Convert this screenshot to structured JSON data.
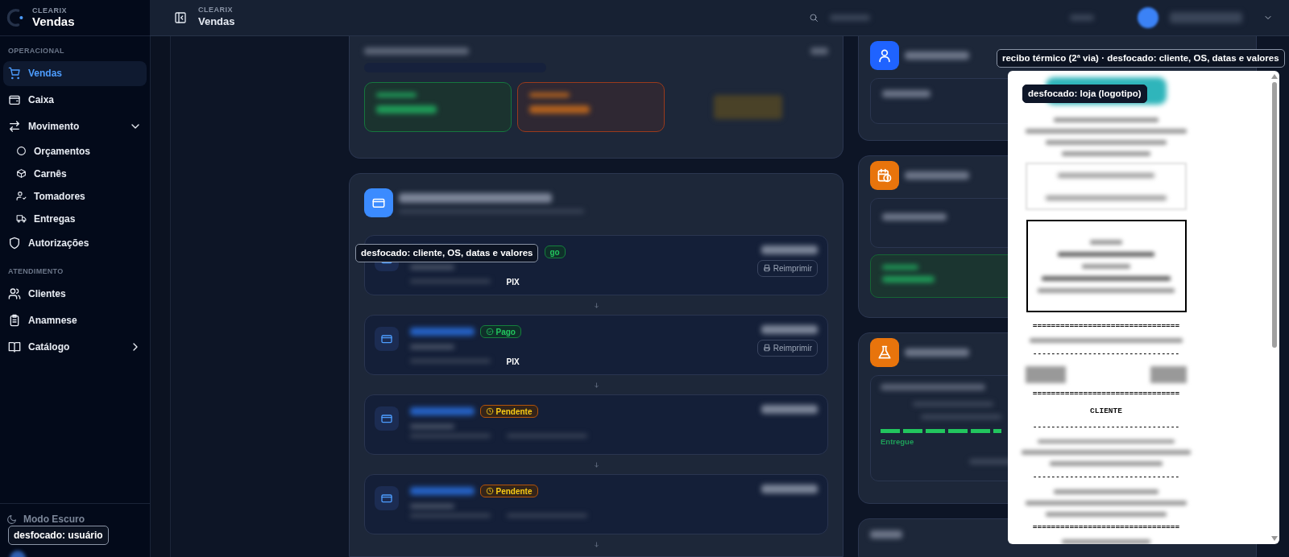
{
  "sidebar": {
    "brand": "CLEARIX",
    "title": "Vendas",
    "sections": [
      {
        "heading": "OPERACIONAL",
        "items": [
          {
            "label": "Vendas",
            "selected": true
          },
          {
            "label": "Caixa",
            "selected": false
          },
          {
            "label": "Movimento",
            "selected": false,
            "expanded": true,
            "children": [
              {
                "label": "Orçamentos",
                "selected": false
              },
              {
                "label": "Carnês",
                "selected": false
              },
              {
                "label": "Tomadores",
                "selected": false
              },
              {
                "label": "Entregas",
                "selected": false
              }
            ]
          },
          {
            "label": "Autorizações",
            "selected": false
          }
        ]
      },
      {
        "heading": "ATENDIMENTO",
        "items": [
          {
            "label": "Clientes",
            "selected": false
          },
          {
            "label": "Anamnese",
            "selected": false
          },
          {
            "label": "Catálogo",
            "selected": false,
            "expanded": false
          }
        ]
      }
    ],
    "theme_toggle": "Modo Escuro",
    "overlay_label": "desfocado: usuário"
  },
  "topbar": {
    "brand": "CLEARIX",
    "title": "Vendas"
  },
  "payments": {
    "overlay_label": "desfocado: cliente, OS, datas e valores",
    "entries": [
      {
        "status": "go",
        "kind": "paid",
        "status_cut": true,
        "method": "PIX",
        "action": "Reimprimir"
      },
      {
        "status": "Pago",
        "kind": "paid",
        "status_cut": false,
        "method": "PIX",
        "action": "Reimprimir"
      },
      {
        "status": "Pendente",
        "kind": "pending",
        "status_cut": false
      },
      {
        "status": "Pendente",
        "kind": "pending",
        "status_cut": false
      }
    ]
  },
  "delivery": {
    "status": "Entregue",
    "level": 1
  },
  "receipt": {
    "caption": "recibo térmico (2ª via) · desfocado: cliente, OS, datas e valores",
    "logo_label": "desfocado: loja (logotipo)",
    "lines": [
      {
        "kind": "blur"
      },
      {
        "kind": "blur"
      },
      {
        "kind": "blur"
      },
      {
        "kind": "blur"
      },
      {
        "kind": "table"
      },
      {
        "kind": "box"
      },
      {
        "kind": "text",
        "text": "================================"
      },
      {
        "kind": "blur"
      },
      {
        "kind": "text",
        "text": "--------------------------------"
      },
      {
        "kind": "pair"
      },
      {
        "kind": "text",
        "text": "================================"
      },
      {
        "kind": "text",
        "text": "CLIENTE"
      },
      {
        "kind": "text",
        "text": "--------------------------------"
      },
      {
        "kind": "blur"
      },
      {
        "kind": "blur"
      },
      {
        "kind": "blur"
      },
      {
        "kind": "text",
        "text": "--------------------------------"
      },
      {
        "kind": "blur"
      },
      {
        "kind": "blur"
      },
      {
        "kind": "blur"
      },
      {
        "kind": "text",
        "text": "================================"
      },
      {
        "kind": "blur"
      }
    ]
  }
}
